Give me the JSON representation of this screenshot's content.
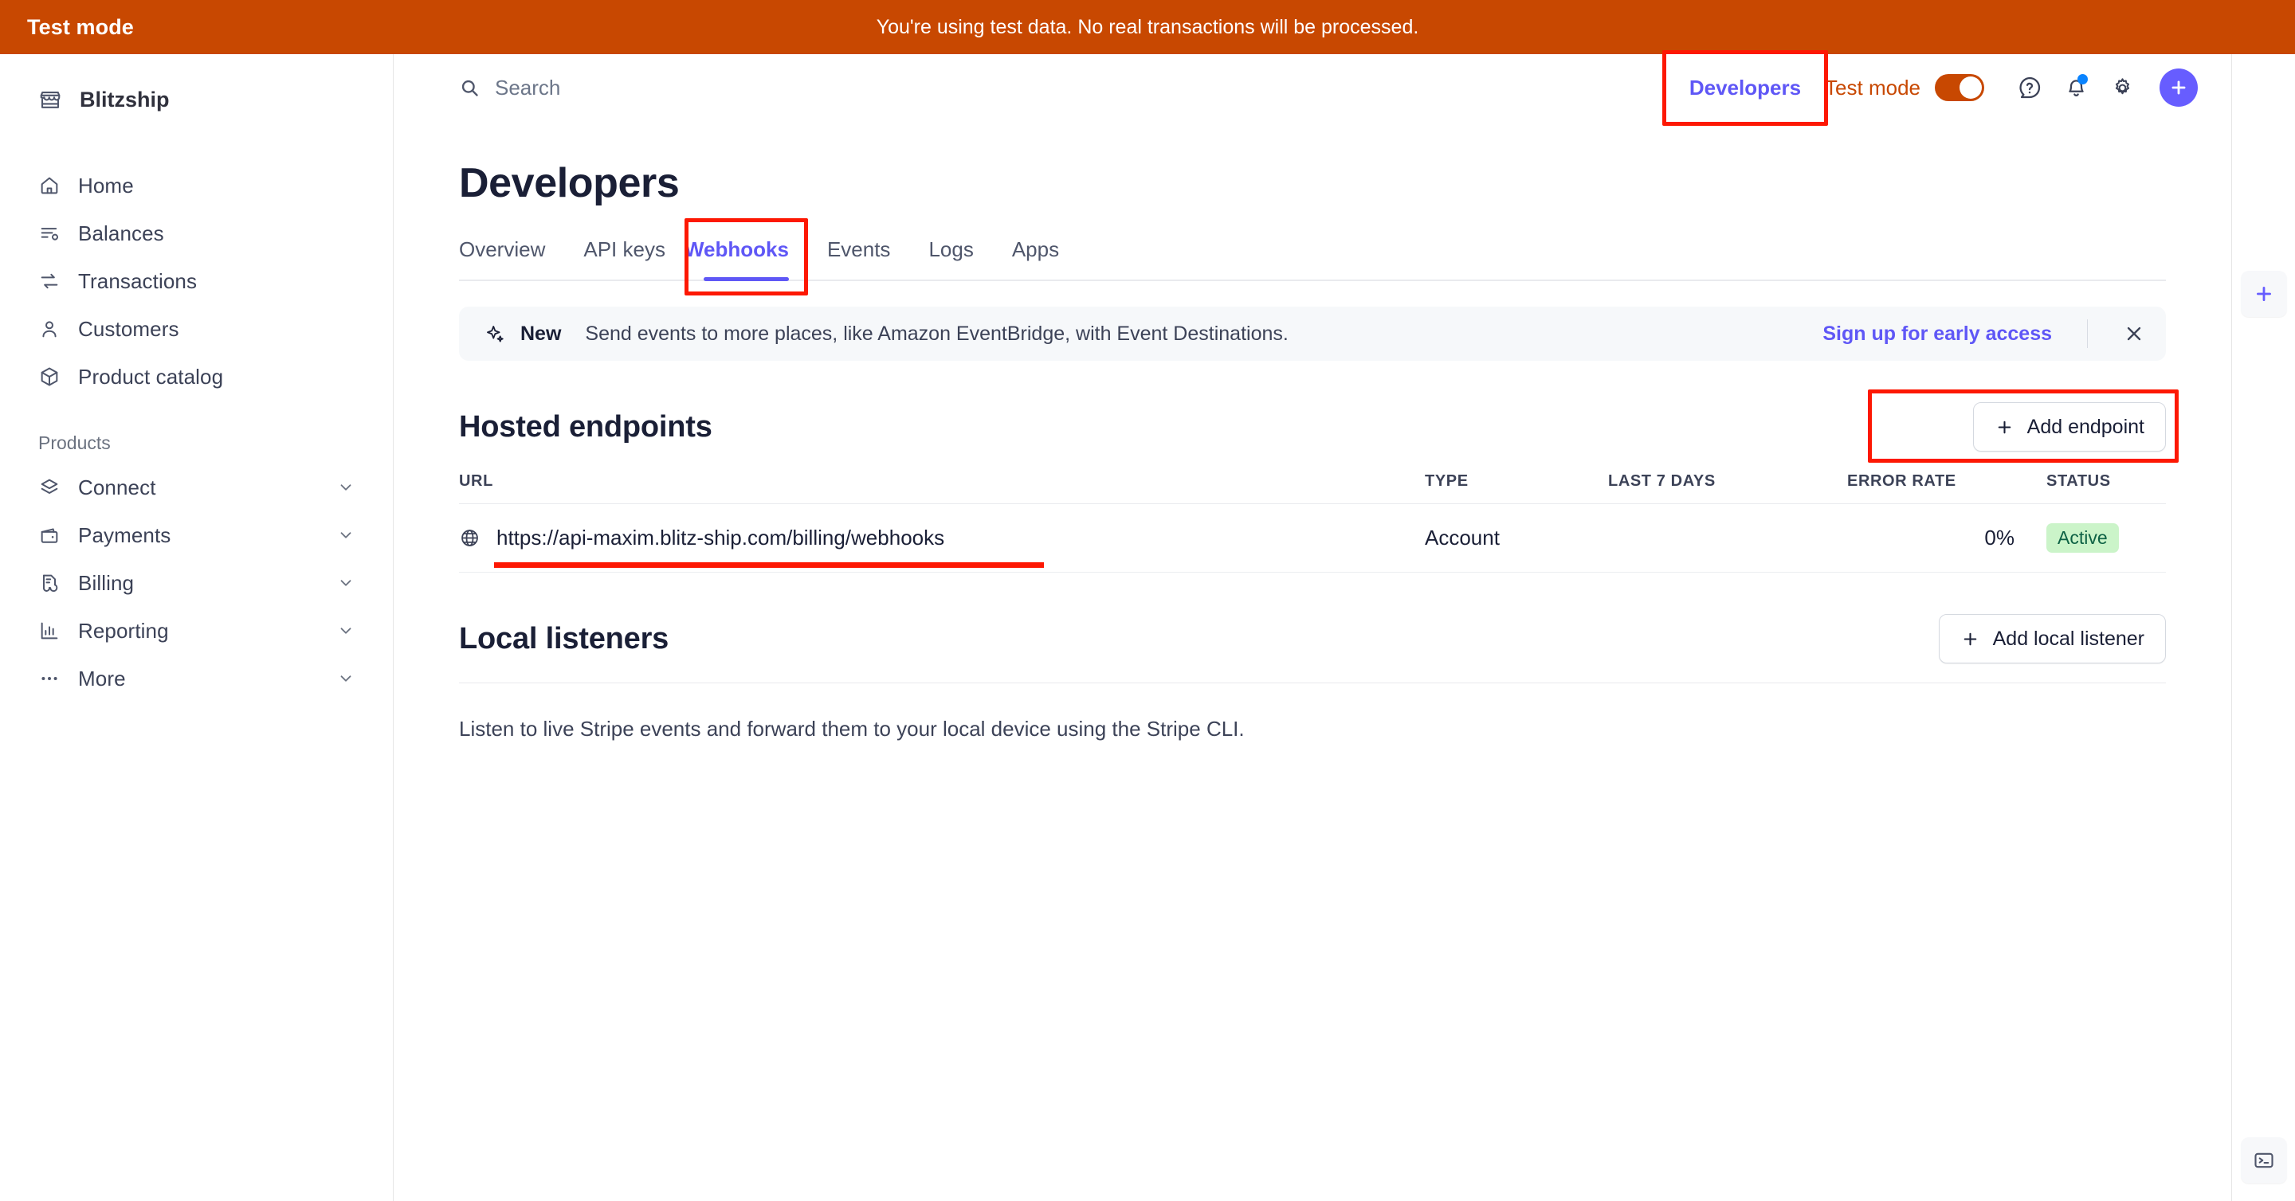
{
  "test_banner": {
    "label": "Test mode",
    "message": "You're using test data. No real transactions will be processed.",
    "color": "#c84801"
  },
  "sidebar": {
    "brand": {
      "name": "Blitzship",
      "icon": "store-icon"
    },
    "items": [
      {
        "label": "Home",
        "icon": "home-icon"
      },
      {
        "label": "Balances",
        "icon": "balances-icon"
      },
      {
        "label": "Transactions",
        "icon": "transactions-icon"
      },
      {
        "label": "Customers",
        "icon": "customers-icon"
      },
      {
        "label": "Product catalog",
        "icon": "product-catalog-icon"
      }
    ],
    "group_title": "Products",
    "product_items": [
      {
        "label": "Connect",
        "icon": "connect-icon",
        "expandable": true
      },
      {
        "label": "Payments",
        "icon": "payments-icon",
        "expandable": true
      },
      {
        "label": "Billing",
        "icon": "billing-icon",
        "expandable": true
      },
      {
        "label": "Reporting",
        "icon": "reporting-icon",
        "expandable": true
      },
      {
        "label": "More",
        "icon": "more-icon",
        "expandable": true
      }
    ]
  },
  "topbar": {
    "search_placeholder": "Search",
    "developers_label": "Developers",
    "test_mode_label": "Test mode",
    "test_mode_on": true,
    "help_icon": "help-icon",
    "notifications_icon": "bell-icon",
    "settings_icon": "gear-icon",
    "create_icon": "plus-icon"
  },
  "page": {
    "title": "Developers",
    "tabs": [
      {
        "label": "Overview",
        "active": false
      },
      {
        "label": "API keys",
        "active": false
      },
      {
        "label": "Webhooks",
        "active": true
      },
      {
        "label": "Events",
        "active": false
      },
      {
        "label": "Logs",
        "active": false
      },
      {
        "label": "Apps",
        "active": false
      }
    ]
  },
  "banner": {
    "icon": "sparkle-icon",
    "new_label": "New",
    "text": "Send events to more places, like Amazon EventBridge, with Event Destinations.",
    "cta": "Sign up for early access",
    "close_icon": "close-icon"
  },
  "hosted_endpoints": {
    "title": "Hosted endpoints",
    "add_button": "Add endpoint",
    "add_icon": "plus-icon",
    "columns": [
      "URL",
      "TYPE",
      "LAST 7 DAYS",
      "ERROR RATE",
      "STATUS"
    ],
    "rows": [
      {
        "icon": "globe-icon",
        "url": "https://api-maxim.blitz-ship.com/billing/webhooks",
        "type": "Account",
        "last_7_days": "",
        "error_rate": "0%",
        "status": "Active"
      }
    ]
  },
  "local_listeners": {
    "title": "Local listeners",
    "add_button": "Add local listener",
    "add_icon": "plus-icon",
    "description": "Listen to live Stripe events and forward them to your local device using the Stripe CLI."
  },
  "right_rail": {
    "add_icon": "plus-icon",
    "terminal_icon": "terminal-icon"
  },
  "annotations": {
    "highlight_color": "#fd1803",
    "underline_color": "#fd1803"
  }
}
